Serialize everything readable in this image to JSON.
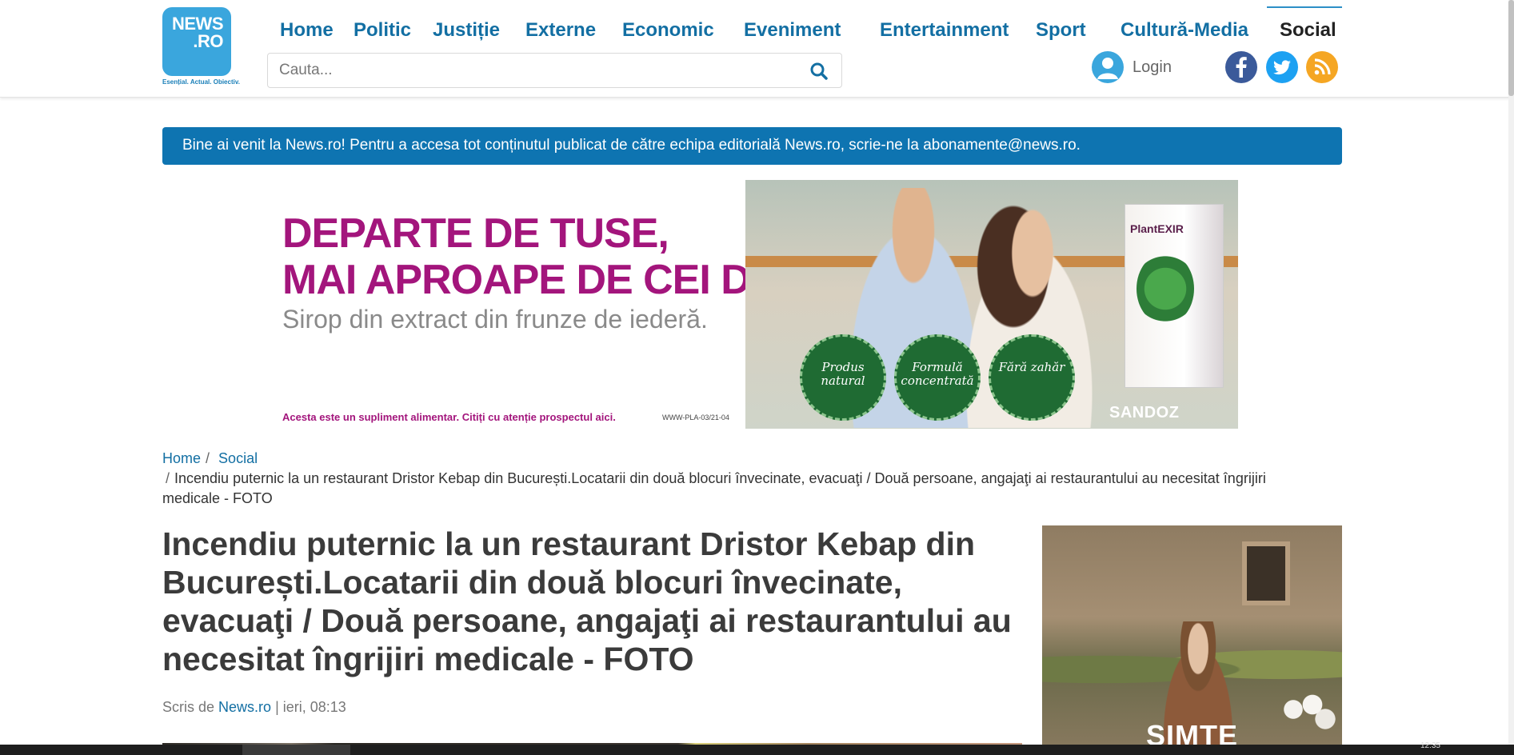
{
  "logo": {
    "text": "NEWS\n.RO",
    "tagline": "Esențial. Actual. Obiectiv."
  },
  "nav": {
    "items": [
      "Home",
      "Politic",
      "Justiție",
      "Externe",
      "Economic",
      "Eveniment",
      "Entertainment",
      "Sport",
      "Cultură-Media",
      "Social"
    ],
    "active": "Social"
  },
  "search": {
    "placeholder": "Cauta..."
  },
  "login": {
    "label": "Login"
  },
  "social": [
    "facebook-icon",
    "twitter-icon",
    "rss-icon"
  ],
  "notice": {
    "text": "Bine ai venit la News.ro! Pentru a accesa tot conținutul publicat de către echipa editorială News.ro, scrie-ne la abonamente@news.ro."
  },
  "ad": {
    "headline_1": "DEPARTE DE TUSE,",
    "headline_2": "MAI APROAPE DE CEI DRAGI.",
    "subline": "Sirop din extract din frunze de iederă.",
    "disclaimer": "Acesta este un supliment alimentar. Citiți cu atenție prospectul aici.",
    "code": "WWW-PLA-03/21-04",
    "badges": [
      "Produs natural",
      "Formulă concentrată",
      "Fără zahăr"
    ],
    "product": "PlantEXIR",
    "brand": "SANDOZ"
  },
  "breadcrumb": {
    "home": "Home",
    "section": "Social",
    "current": "Incendiu puternic la un restaurant Dristor Kebap din București.Locatarii din două blocuri învecinate, evacuaţi / Două persoane, angajaţi ai restaurantului au necesitat îngrijiri medicale - FOTO"
  },
  "article": {
    "title": "Incendiu puternic la un restaurant Dristor Kebap din București.Locatarii din două blocuri învecinate, evacuaţi / Două persoane, angajaţi ai restaurantului au necesitat îngrijiri medicale - FOTO",
    "byline_prefix": "Scris de",
    "author": "News.ro",
    "byline_suffix": "| ieri, 08:13"
  },
  "side_ad": {
    "text": "SIMTE"
  },
  "taskbar": {
    "clock": "12:35"
  },
  "colors": {
    "brand": "#136fa3",
    "logo": "#3aa6dd",
    "notice": "#0e74b1",
    "ad_magenta": "#a3157c"
  }
}
